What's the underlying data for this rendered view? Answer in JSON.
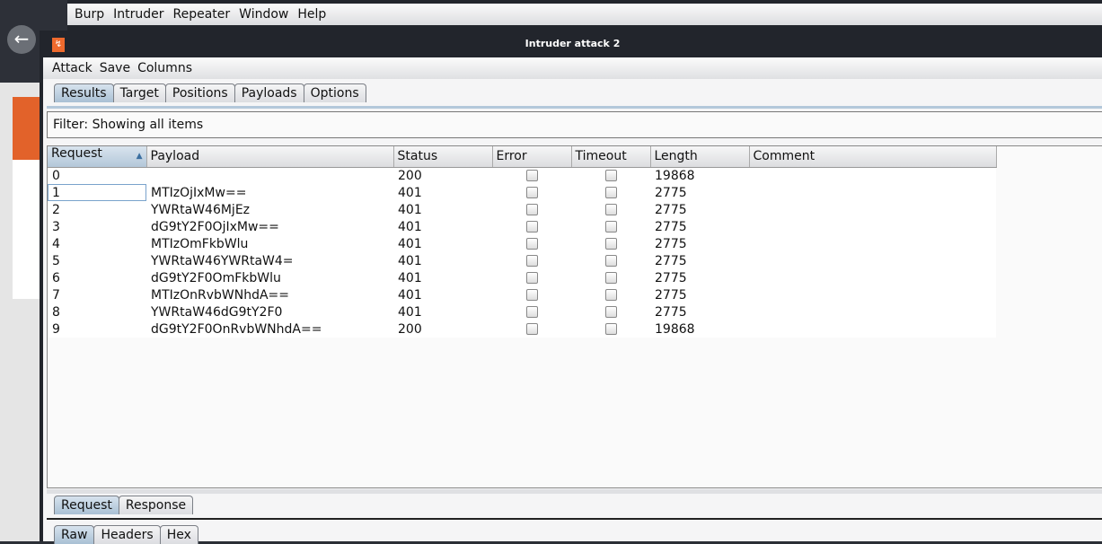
{
  "main_menu": [
    "Burp",
    "Intruder",
    "Repeater",
    "Window",
    "Help"
  ],
  "window_title": "Intruder attack 2",
  "attack_menu": [
    "Attack",
    "Save",
    "Columns"
  ],
  "tabs": [
    {
      "label": "Results",
      "selected": true
    },
    {
      "label": "Target"
    },
    {
      "label": "Positions"
    },
    {
      "label": "Payloads"
    },
    {
      "label": "Options"
    }
  ],
  "filter": "Filter: Showing all items",
  "table": {
    "columns": [
      "Request",
      "Payload",
      "Status",
      "Error",
      "Timeout",
      "Length",
      "Comment"
    ],
    "sorted_column": "Request",
    "sort_direction": "ascending",
    "rows": [
      {
        "request": "0",
        "payload": "",
        "status": "200",
        "error": false,
        "timeout": false,
        "length": "19868",
        "comment": ""
      },
      {
        "request": "1",
        "payload": "MTIzOjIxMw==",
        "status": "401",
        "error": false,
        "timeout": false,
        "length": "2775",
        "comment": ""
      },
      {
        "request": "2",
        "payload": "YWRtaW46MjEz",
        "status": "401",
        "error": false,
        "timeout": false,
        "length": "2775",
        "comment": ""
      },
      {
        "request": "3",
        "payload": "dG9tY2F0OjIxMw==",
        "status": "401",
        "error": false,
        "timeout": false,
        "length": "2775",
        "comment": ""
      },
      {
        "request": "4",
        "payload": "MTIzOmFkbWlu",
        "status": "401",
        "error": false,
        "timeout": false,
        "length": "2775",
        "comment": ""
      },
      {
        "request": "5",
        "payload": "YWRtaW46YWRtaW4=",
        "status": "401",
        "error": false,
        "timeout": false,
        "length": "2775",
        "comment": ""
      },
      {
        "request": "6",
        "payload": "dG9tY2F0OmFkbWlu",
        "status": "401",
        "error": false,
        "timeout": false,
        "length": "2775",
        "comment": ""
      },
      {
        "request": "7",
        "payload": "MTIzOnRvbWNhdA==",
        "status": "401",
        "error": false,
        "timeout": false,
        "length": "2775",
        "comment": ""
      },
      {
        "request": "8",
        "payload": "YWRtaW46dG9tY2F0",
        "status": "401",
        "error": false,
        "timeout": false,
        "length": "2775",
        "comment": ""
      },
      {
        "request": "9",
        "payload": "dG9tY2F0OnRvbWNhdA==",
        "status": "200",
        "error": false,
        "timeout": false,
        "length": "19868",
        "comment": ""
      }
    ]
  },
  "detail_tabs": [
    {
      "label": "Request",
      "selected": true
    },
    {
      "label": "Response"
    }
  ],
  "view_tabs": [
    {
      "label": "Raw",
      "selected": true
    },
    {
      "label": "Headers"
    },
    {
      "label": "Hex"
    }
  ],
  "icons": {
    "back": "arrow-left-icon",
    "logo": "burp-logo-icon",
    "sort": "sort-ascending-icon"
  }
}
